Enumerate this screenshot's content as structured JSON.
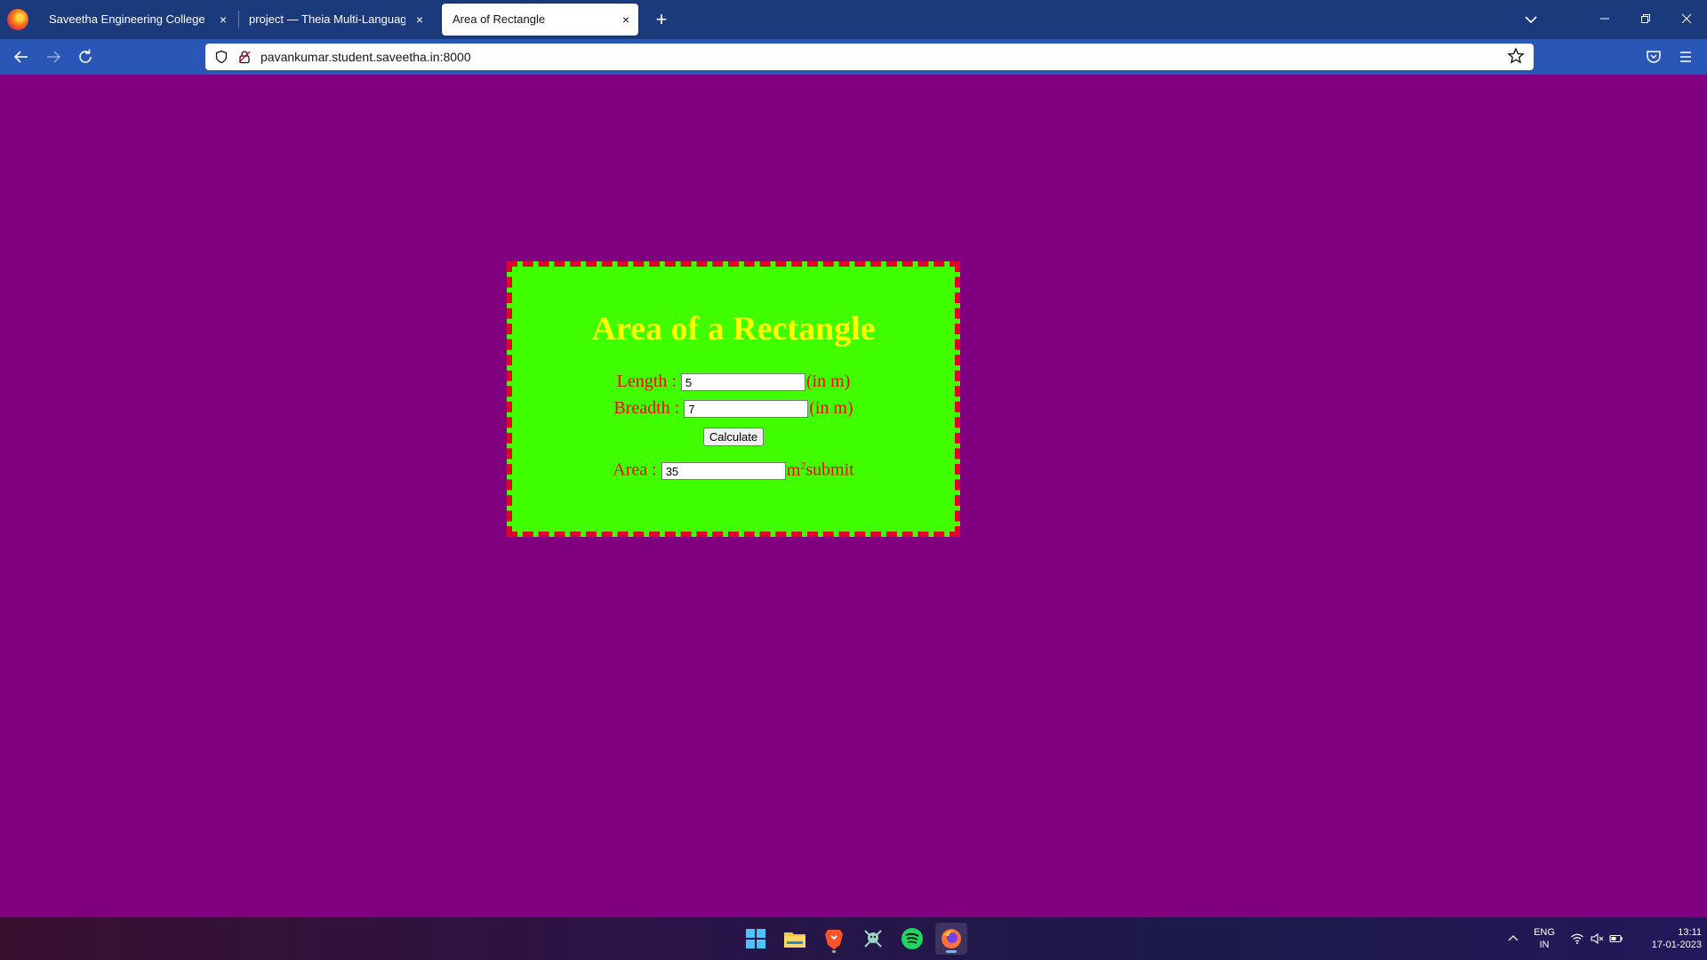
{
  "browser": {
    "tabs": [
      {
        "label": "Saveetha Engineering College",
        "close": "×",
        "active": false
      },
      {
        "label": "project — Theia Multi-Language Ex",
        "close": "×",
        "active": false
      },
      {
        "label": "Area of Rectangle",
        "close": "×",
        "active": true
      }
    ],
    "new_tab": "+",
    "url": "pavankumar.student.saveetha.in:8000"
  },
  "page": {
    "heading": "Area of a Rectangle",
    "length_label": "Length :",
    "length_value": "5",
    "length_unit": "(in m)",
    "breadth_label": "Breadth :",
    "breadth_value": "7",
    "breadth_unit": "(in m)",
    "calculate_label": "Calculate",
    "area_label": "Area :",
    "area_value": "35",
    "area_unit_base": "m",
    "area_unit_sup": "2",
    "area_suffix": "submit"
  },
  "taskbar": {
    "apps": [
      "windows-start-icon",
      "file-explorer-icon",
      "brave-browser-icon",
      "game-app-icon",
      "spotify-icon",
      "firefox-icon"
    ],
    "language": "ENG",
    "region": "IN",
    "time": "13:11",
    "date": "17-01-2023"
  },
  "colors": {
    "page_bg": "#800080",
    "card_bg": "#40ff00",
    "card_border": "#e0002a",
    "heading": "#ffff00",
    "label_text": "#ff0000",
    "tabbar_bg": "#1a3a7c",
    "navbar_bg": "#2a56b8"
  }
}
